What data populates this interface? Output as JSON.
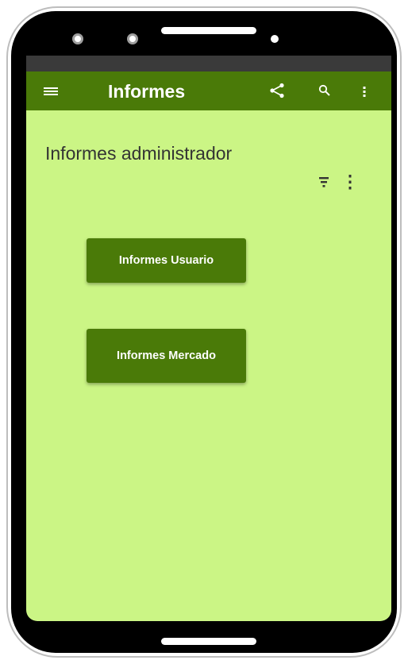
{
  "app_bar": {
    "title": "Informes",
    "menu_icon": "hamburger-menu-icon",
    "share_icon": "share-icon",
    "search_icon": "search-icon",
    "more_icon": "more-vert-icon",
    "background_color": "#4a7a08"
  },
  "content": {
    "title": "Informes administrador",
    "filter_icon": "filter-icon",
    "more_icon": "more-vert-icon",
    "background_color": "#cbf585"
  },
  "buttons": {
    "usuario_label": "Informes Usuario",
    "mercado_label": "Informes Mercado"
  }
}
